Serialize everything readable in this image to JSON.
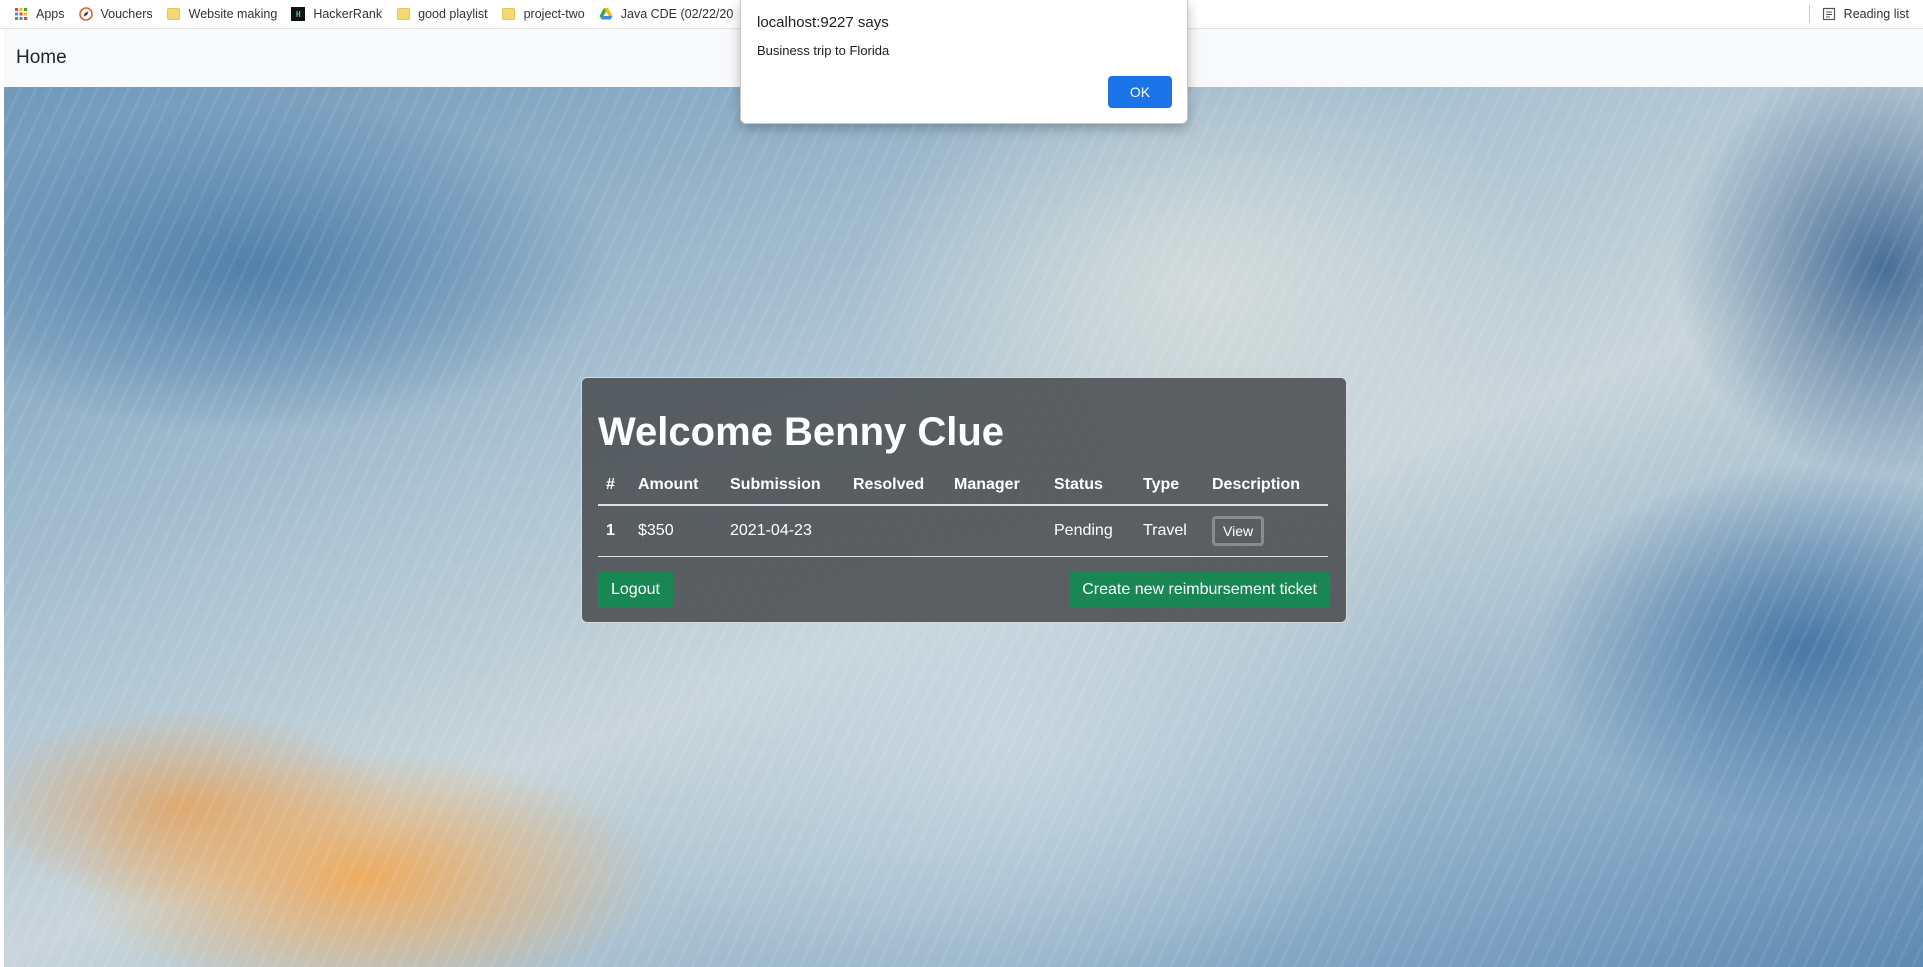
{
  "bookmarks": {
    "items": [
      {
        "label": "Apps",
        "icon": "apps-grid-icon"
      },
      {
        "label": "Vouchers",
        "icon": "compass-icon"
      },
      {
        "label": "Website making",
        "icon": "folder-icon"
      },
      {
        "label": "HackerRank",
        "icon": "hackerrank-icon"
      },
      {
        "label": "good playlist",
        "icon": "folder-icon"
      },
      {
        "label": "project-two",
        "icon": "folder-icon"
      },
      {
        "label": "Java CDE (02/22/20",
        "icon": "google-drive-icon"
      }
    ],
    "reading_list": "Reading list"
  },
  "navbar": {
    "brand": "Home"
  },
  "card": {
    "title": "Welcome Benny Clue",
    "columns": [
      "#",
      "Amount",
      "Submission",
      "Resolved",
      "Manager",
      "Status",
      "Type",
      "Description"
    ],
    "rows": [
      {
        "id": "1",
        "amount": "$350",
        "submission": "2021-04-23",
        "resolved": "",
        "manager": "",
        "status": "Pending",
        "type": "Travel",
        "description_button": "View"
      }
    ],
    "logout_label": "Logout",
    "create_label": "Create new reimbursement ticket"
  },
  "alert": {
    "origin": "localhost:9227 says",
    "message": "Business trip to Florida",
    "ok_label": "OK"
  },
  "colors": {
    "success": "#198754",
    "dialog_button": "#1a73e8",
    "navbar_bg": "#f8f9fa"
  }
}
